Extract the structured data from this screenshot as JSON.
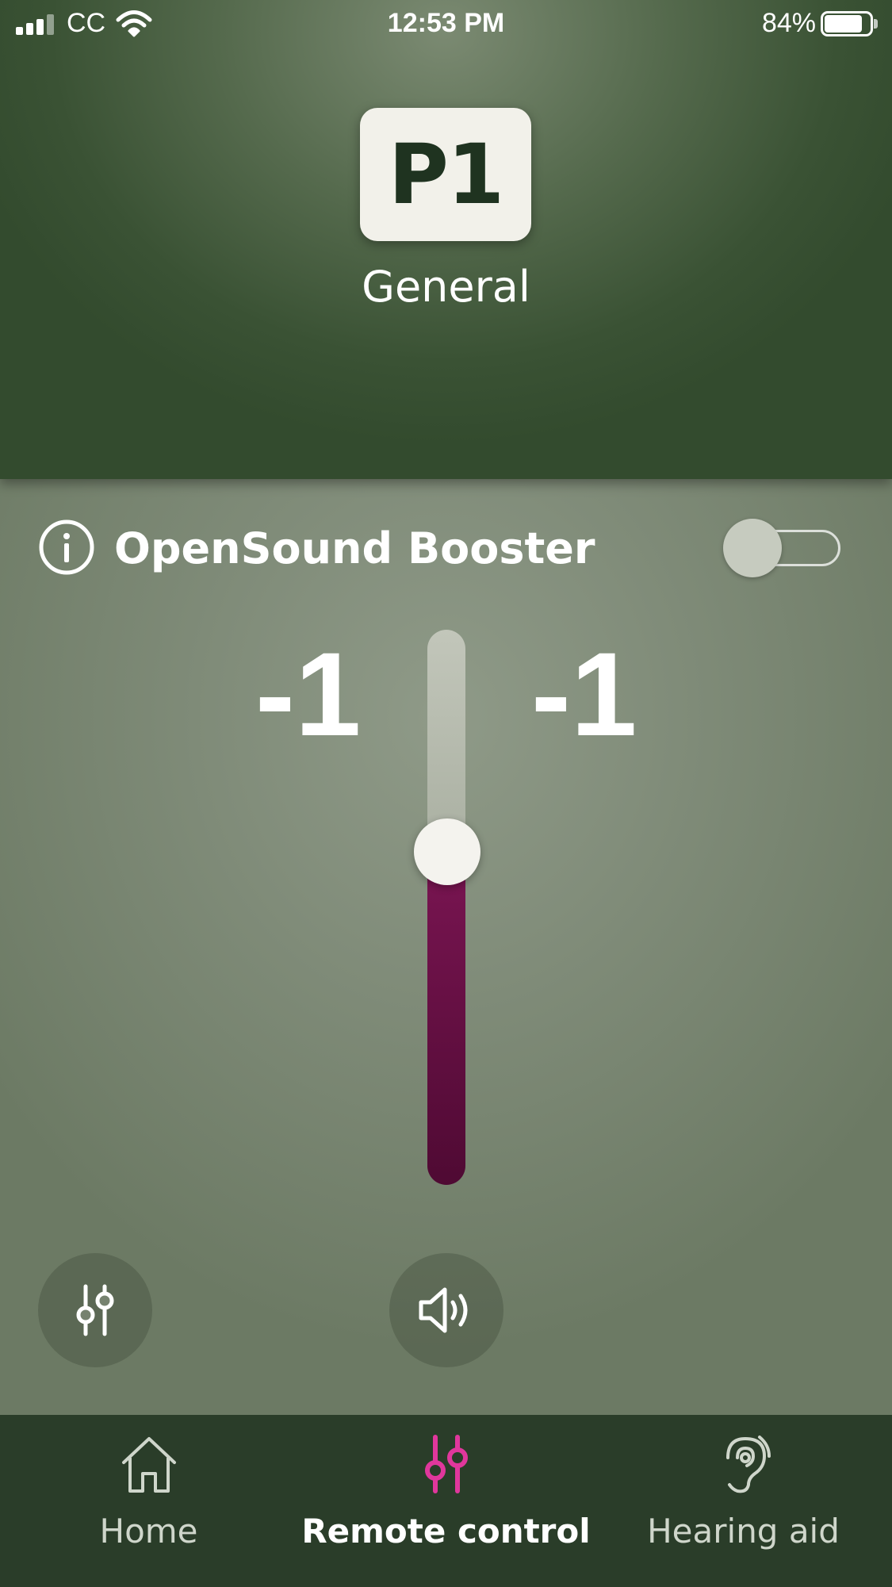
{
  "status_bar": {
    "carrier": "CC",
    "time": "12:53 PM",
    "battery_percent_label": "84%",
    "battery_level": 0.84
  },
  "program": {
    "badge": "P1",
    "name": "General"
  },
  "booster": {
    "label": "OpenSound Booster",
    "enabled": false
  },
  "volume": {
    "left": "-1",
    "right": "-1",
    "slider_level": 0.6
  },
  "controls": {
    "equalizer_icon": "sliders-icon",
    "sound_icon": "speaker-icon"
  },
  "tabs": [
    {
      "label": "Home",
      "icon": "home-icon",
      "active": false
    },
    {
      "label": "Remote control",
      "icon": "sliders-icon",
      "active": true
    },
    {
      "label": "Hearing aid",
      "icon": "ear-icon",
      "active": false
    }
  ],
  "colors": {
    "accent": "#e0379c",
    "volume_fill": "#6a1045",
    "tab_bar": "#2a3d29",
    "header": "#3a5234"
  }
}
